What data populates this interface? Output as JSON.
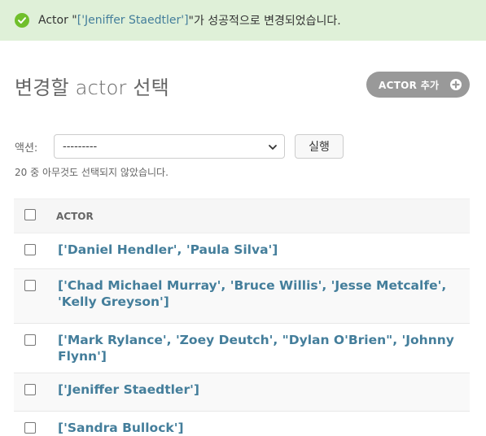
{
  "message": {
    "prefix": "Actor \"",
    "link": "['Jeniffer Staedtler']",
    "suffix": "\"가 성공적으로 변경되었습니다."
  },
  "page_title": "변경할 actor 선택",
  "add_button": "ACTOR 추가",
  "actions": {
    "label": "액션:",
    "selected": "---------",
    "run_label": "실행"
  },
  "counter": "20 중 아무것도 선택되지 않았습니다.",
  "table": {
    "column_header": "ACTOR",
    "rows": [
      "['Daniel Hendler', 'Paula Silva']",
      "['Chad Michael Murray', 'Bruce Willis', 'Jesse Metcalfe', 'Kelly Greyson']",
      "['Mark Rylance', 'Zoey Deutch', \"Dylan O'Brien\", 'Johnny Flynn']",
      "['Jeniffer Staedtler']",
      "['Sandra Bullock']"
    ]
  },
  "colors": {
    "success_bg": "#dff0d8",
    "success_icon": "#70bf2b",
    "link": "#447e9b",
    "button_gray": "#999999"
  },
  "icons": [
    "check-circle-icon",
    "plus-icon",
    "chevron-down-icon"
  ]
}
